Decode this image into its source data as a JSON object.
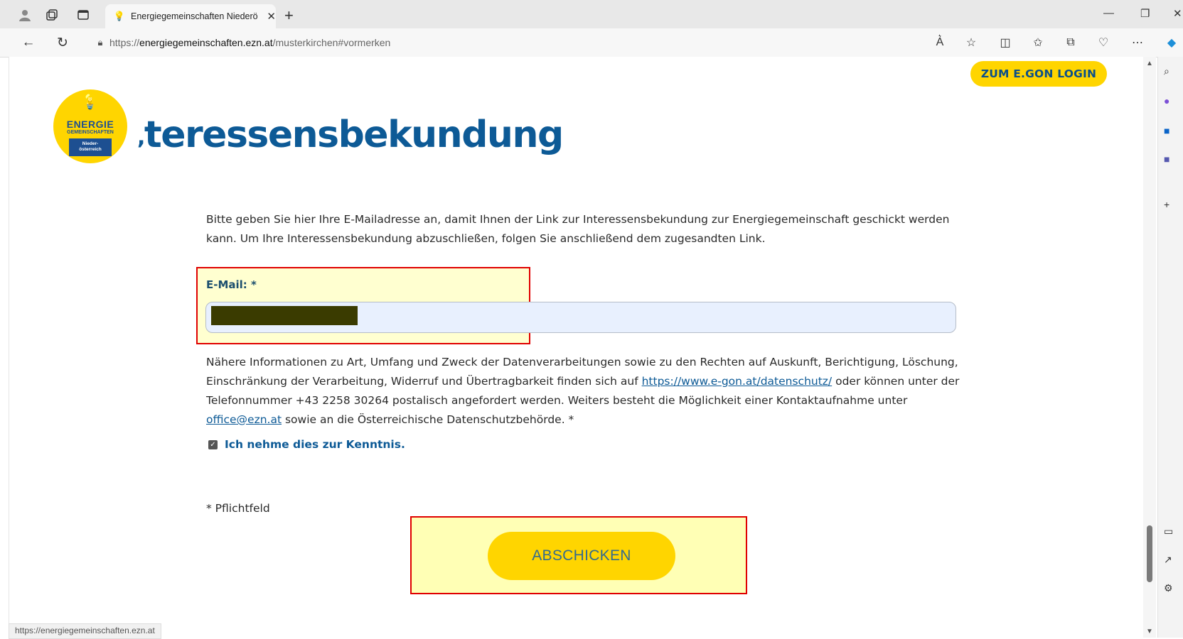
{
  "browser": {
    "tab_title": "Energiegemeinschaften Niederö",
    "url_scheme": "https://",
    "url_host": "energiegemeinschaften.ezn.at",
    "url_path": "/musterkirchen#vormerken",
    "status_url": "https://energiegemeinschaften.ezn.at"
  },
  "header": {
    "login_button": "ZUM E.GON LOGIN",
    "logo_line1": "ENERGIE",
    "logo_line2": "GEMEINSCHAFTEN",
    "logo_line3": "Nieder-",
    "logo_line4": "österreich",
    "title": "teressensbekundung"
  },
  "form": {
    "intro": "Bitte geben Sie hier Ihre E-Mailadresse an, damit Ihnen der Link zur Interessensbekundung zur Energiegemeinschaft geschickt werden kann. Um Ihre Interessensbekundung abzuschließen, folgen Sie anschließend dem zugesandten Link.",
    "email_label": "E-Mail: *",
    "email_value": "",
    "info_part1": "Nähere Informationen zu Art, Umfang und Zweck der Datenverarbeitungen sowie zu den Rechten auf Auskunft, Berichtigung, Löschung, Einschränkung der Verarbeitung, Widerruf und Übertragbarkeit finden sich auf ",
    "info_link": "https://www.e-gon.at/datenschutz/",
    "info_part2": " oder können unter der Telefonnummer +43 2258 30264 postalisch angefordert werden. Weiters besteht die Möglichkeit einer Kontaktaufnahme unter ",
    "info_email": "office@ezn.at",
    "info_part3": " sowie an die Österreichische Datenschutzbehörde. *",
    "checkbox_label": "Ich nehme dies zur Kenntnis.",
    "checkbox_checked": true,
    "required_note": "* Pflichtfeld",
    "submit_label": "ABSCHICKEN"
  }
}
